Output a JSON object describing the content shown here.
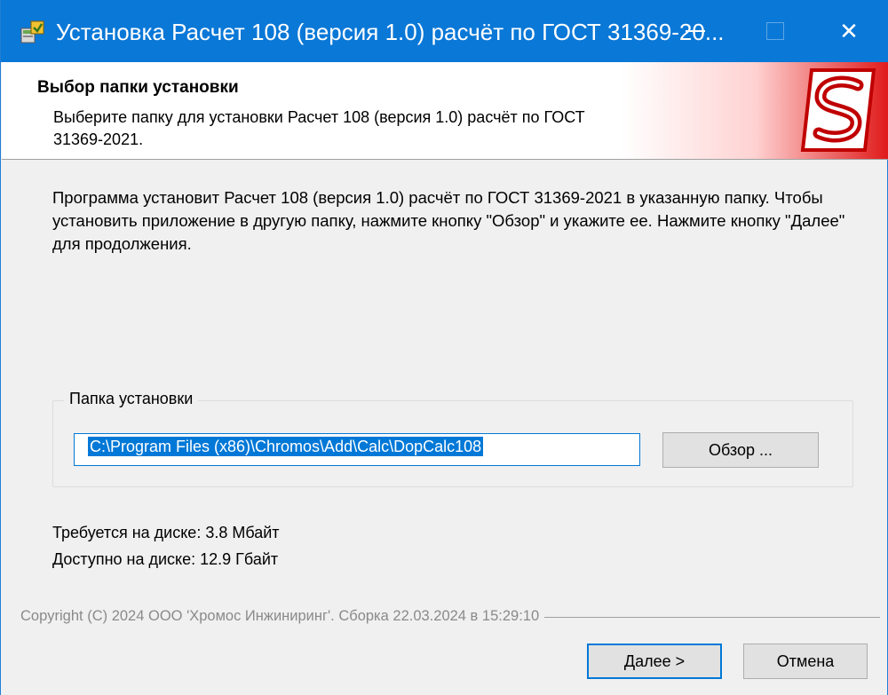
{
  "window": {
    "title": "Установка Расчет 108 (версия 1.0) расчёт по ГОСТ 31369-20...",
    "controls": {
      "minimize": "",
      "maximize": "",
      "close": "✕"
    }
  },
  "header": {
    "title": "Выбор папки установки",
    "description": "Выберите папку для установки Расчет 108 (версия 1.0) расчёт по ГОСТ 31369-2021."
  },
  "body": {
    "text": "Программа установит Расчет 108 (версия 1.0) расчёт по ГОСТ 31369-2021 в указанную папку. Чтобы установить приложение в другую папку, нажмите кнопку \"Обзор\" и укажите ее. Нажмите кнопку \"Далее\" для продолжения."
  },
  "install_folder": {
    "group_label": "Папка установки",
    "path": "C:\\Program Files (x86)\\Chromos\\Add\\Calc\\DopCalc108",
    "browse_label": "Обзор ..."
  },
  "disk": {
    "required": "Требуется на диске: 3.8 Мбайт",
    "available": "Доступно на диске: 12.9 Гбайт"
  },
  "footer": {
    "copyright": "Copyright (C) 2024 ООО 'Хромос Инжиниринг'. Сборка 22.03.2024 в 15:29:10"
  },
  "buttons": {
    "next": "Далее >",
    "cancel": "Отмена"
  },
  "colors": {
    "titlebar": "#0a78d7",
    "accent": "#0078d7",
    "logo_red": "#e01b1b"
  },
  "icons": {
    "app": "installer-icon",
    "logo": "chromos-s-logo"
  }
}
